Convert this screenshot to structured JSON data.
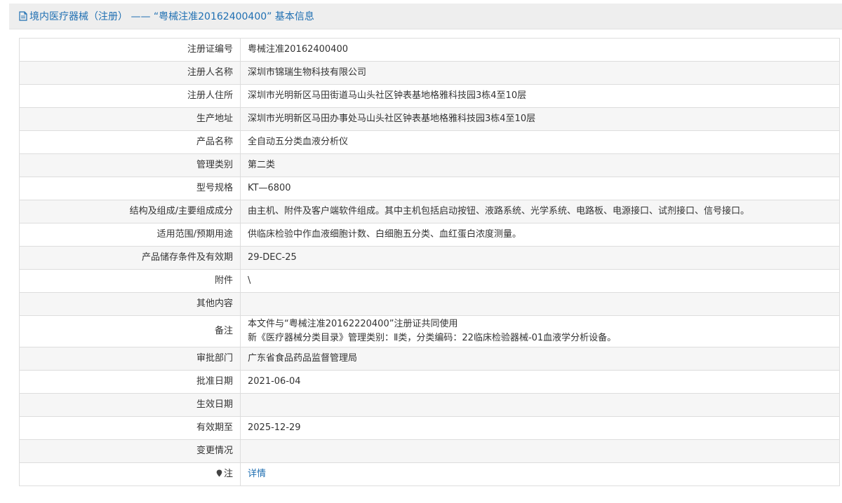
{
  "header": {
    "title": "境内医疗器械（注册） —— “粤械注准20162400400” 基本信息"
  },
  "rows": [
    {
      "label": "注册证编号",
      "value": "粤械注准20162400400"
    },
    {
      "label": "注册人名称",
      "value": "深圳市锦瑞生物科技有限公司"
    },
    {
      "label": "注册人住所",
      "value": "深圳市光明新区马田街道马山头社区钟表基地格雅科技园3栋4至10层"
    },
    {
      "label": "生产地址",
      "value": "深圳市光明新区马田办事处马山头社区钟表基地格雅科技园3栋4至10层"
    },
    {
      "label": "产品名称",
      "value": "全自动五分类血液分析仪"
    },
    {
      "label": "管理类别",
      "value": "第二类"
    },
    {
      "label": "型号规格",
      "value": "KT—6800"
    },
    {
      "label": "结构及组成/主要组成成分",
      "value": "由主机、附件及客户端软件组成。其中主机包括启动按钮、液路系统、光学系统、电路板、电源接口、试剂接口、信号接口。"
    },
    {
      "label": "适用范围/预期用途",
      "value": "供临床检验中作血液细胞计数、白细胞五分类、血红蛋白浓度测量。"
    },
    {
      "label": "产品储存条件及有效期",
      "value": "29-DEC-25"
    },
    {
      "label": "附件",
      "value": "\\"
    },
    {
      "label": "其他内容",
      "value": ""
    },
    {
      "label": "备注",
      "value_line1": "本文件与“粤械注准20162220400”注册证共同使用",
      "value_line2": "新《医疗器械分类目录》管理类别：Ⅱ类，分类编码：22临床检验器械-01血液学分析设备。"
    },
    {
      "label": "审批部门",
      "value": "广东省食品药品监督管理局"
    },
    {
      "label": "批准日期",
      "value": "2021-06-04"
    },
    {
      "label": "生效日期",
      "value": ""
    },
    {
      "label": "有效期至",
      "value": "2025-12-29"
    },
    {
      "label": "变更情况",
      "value": ""
    },
    {
      "label": "注",
      "value": "详情",
      "icon": "pin-icon"
    }
  ]
}
